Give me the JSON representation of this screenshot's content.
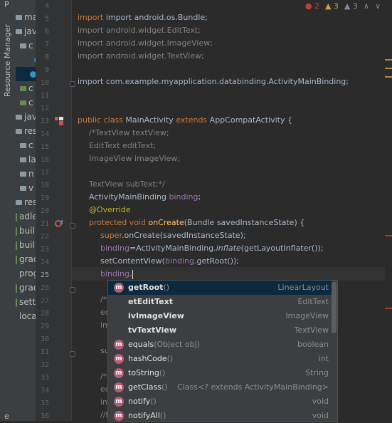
{
  "left_strip": {
    "top_label": "P",
    "resource_manager_label": "Resource Manager",
    "bottom_label": "e"
  },
  "tree_items": [
    {
      "label": "man",
      "icon": "manifest-icon"
    },
    {
      "label": "java",
      "icon": "folder-icon"
    },
    {
      "label": "c",
      "icon": "folder-icon"
    },
    {
      "label": "",
      "icon": "class-icon"
    },
    {
      "label": "",
      "icon": "class-icon",
      "selected": true
    },
    {
      "label": "c",
      "icon": "folder-green-icon"
    },
    {
      "label": "c",
      "icon": "folder-green-icon"
    },
    {
      "label": "java",
      "icon": "folder-icon"
    },
    {
      "label": "res",
      "icon": "folder-icon"
    },
    {
      "label": "c",
      "icon": "folder-icon"
    },
    {
      "label": "la",
      "icon": "folder-icon"
    },
    {
      "label": "n",
      "icon": "folder-icon"
    },
    {
      "label": "v",
      "icon": "folder-icon"
    },
    {
      "label": "res (",
      "icon": "folder-icon"
    },
    {
      "label": "adle S",
      "icon": "gradle-icon"
    },
    {
      "label": "buil",
      "icon": "gradle-icon"
    },
    {
      "label": "buil",
      "icon": "gradle-icon"
    },
    {
      "label": "grad",
      "icon": "gradle-icon"
    },
    {
      "label": "prog",
      "icon": "file-icon"
    },
    {
      "label": "grad",
      "icon": "gradle-icon"
    },
    {
      "label": "setti",
      "icon": "gradle-icon"
    },
    {
      "label": "local",
      "icon": "file-icon"
    }
  ],
  "status": {
    "errors": "2",
    "warnings": "3",
    "weak_warnings": "3"
  },
  "line_numbers": [
    "4",
    "5",
    "6",
    "7",
    "8",
    "9",
    "10",
    "11",
    "12",
    "13",
    "14",
    "15",
    "16",
    "17",
    "18",
    "19",
    "20",
    "21",
    "22",
    "23",
    "24",
    "25",
    "26",
    "27",
    "28",
    "29",
    "30",
    "31",
    "32",
    "33",
    "34",
    "35",
    "36"
  ],
  "code": {
    "l4": "import android.os.Bundle;",
    "l5": "import android.widget.EditText;",
    "l6": "import android.widget.ImageView;",
    "l7": "import android.widget.TextView;",
    "l9": "import com.example.myapplication.databinding.ActivityMainBinding;",
    "l13_kw": "public class ",
    "l13_name": "MainActivity ",
    "l13_kw2": "extends ",
    "l13_rest": "AppCompatActivity {",
    "l14": "/*TextView textView;",
    "l15": "EditText editText;",
    "l16": "ImageView imageView;",
    "l18": "TextView subText;*/",
    "l19_type": "ActivityMainBinding ",
    "l19_field": "binding",
    "l19_end": ";",
    "l20": "@Override",
    "l21_kw": "protected void ",
    "l21_fn": "onCreate",
    "l21_rest": "(Bundle savedInstanceState) {",
    "l22_kw": "super",
    "l22_rest": ".onCreate(savedInstanceState);",
    "l23_field": "binding",
    "l23_mid": "=ActivityMainBinding.",
    "l23_it": "inflate",
    "l23_rest": "(getLayoutInflater());",
    "l24_a": "setContentView(",
    "l24_field": "binding",
    "l24_rest": ".getRoot());",
    "l25_field": "binding",
    "l25_dot": ".",
    "l27": "/*",
    "l28": "ed",
    "l29": "im",
    "l31": "su",
    "l33": "/*",
    "l34": "ed",
    "l35": "im",
    "l36": "//f"
  },
  "completion_items": [
    {
      "name": "getRoot",
      "sig": "()",
      "type": "LinearLayout",
      "icon": "method-icon",
      "bold": true,
      "selected": true
    },
    {
      "name": "etEditText",
      "sig": "",
      "type": "EditText",
      "icon": "none",
      "bold": true
    },
    {
      "name": "ivImageView",
      "sig": "",
      "type": "ImageView",
      "icon": "none",
      "bold": true
    },
    {
      "name": "tvTextView",
      "sig": "",
      "type": "TextView",
      "icon": "none",
      "bold": true
    },
    {
      "name": "equals",
      "sig": "(Object obj)",
      "type": "boolean",
      "icon": "method-icon"
    },
    {
      "name": "hashCode",
      "sig": "()",
      "type": "int",
      "icon": "method-icon"
    },
    {
      "name": "toString",
      "sig": "()",
      "type": "String",
      "icon": "method-icon"
    },
    {
      "name": "getClass",
      "sig": "()",
      "type": "Class<? extends ActivityMainBinding>",
      "icon": "method-icon"
    },
    {
      "name": "notify",
      "sig": "()",
      "type": "void",
      "icon": "method-lock-icon"
    },
    {
      "name": "notifyAll",
      "sig": "()",
      "type": "void",
      "icon": "method-lock-icon"
    }
  ],
  "colors": {
    "background": "#2b2b2b",
    "keyword": "#cc7832",
    "comment": "#808080",
    "field": "#9876aa",
    "method": "#ffc66d",
    "annotation": "#bbb529",
    "selection": "#0d293e"
  }
}
